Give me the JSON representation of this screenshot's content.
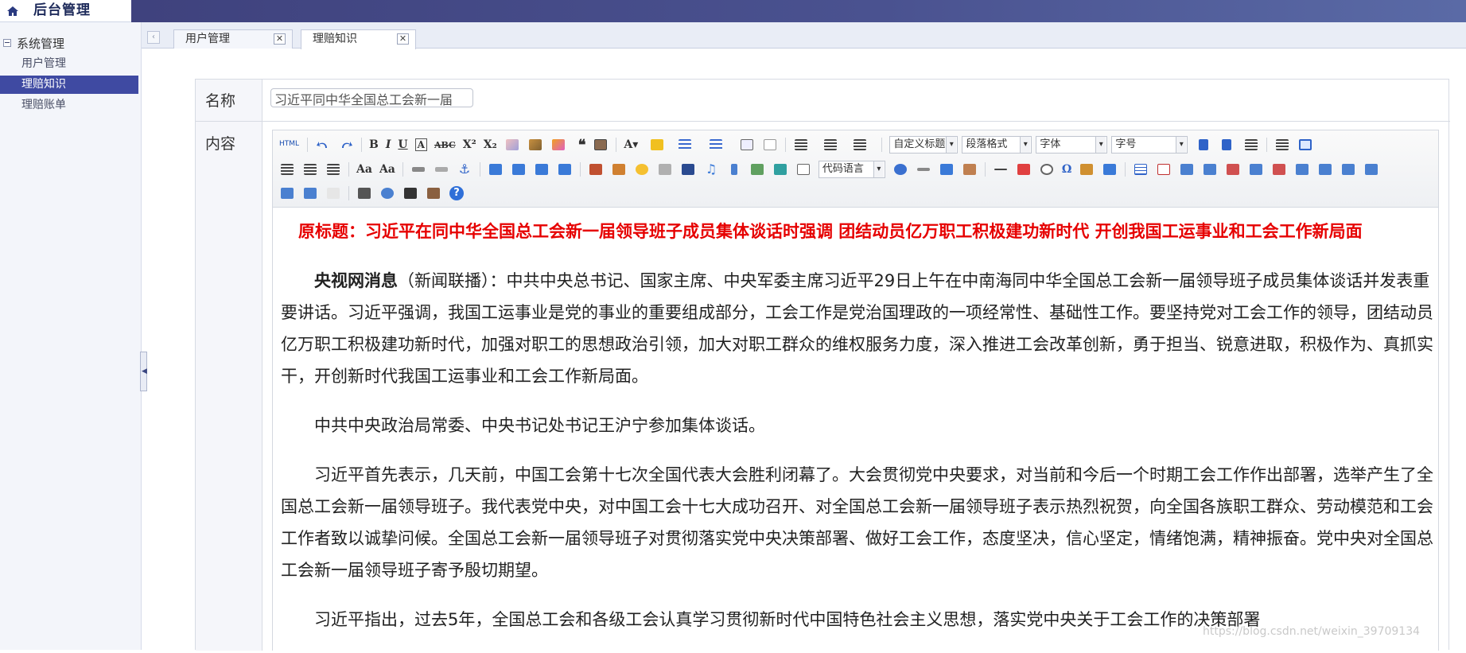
{
  "app": {
    "title": "后台管理"
  },
  "sidebar": {
    "group_label": "系统管理",
    "items": [
      {
        "label": "用户管理",
        "active": false
      },
      {
        "label": "理赔知识",
        "active": true
      },
      {
        "label": "理赔账单",
        "active": false
      }
    ]
  },
  "tabs": [
    {
      "label": "用户管理",
      "active": false
    },
    {
      "label": "理赔知识",
      "active": true
    }
  ],
  "form": {
    "name_label": "名称",
    "name_value": "习近平同中华全国总工会新一届",
    "content_label": "内容"
  },
  "toolbar": {
    "html_label": "HTML",
    "custom_title": "自定义标题",
    "paragraph_format": "段落格式",
    "font_family": "字体",
    "font_size": "字号",
    "code_language": "代码语言",
    "icons": [
      "html-icon",
      "undo-icon",
      "redo-icon",
      "bold-icon",
      "italic-icon",
      "underline-icon",
      "font-border-icon",
      "strikethrough-icon",
      "superscript-icon",
      "subscript-icon",
      "eraser-icon",
      "format-brush-icon",
      "autotype-icon",
      "blockquote-icon",
      "paste-text-icon",
      "font-color-icon",
      "back-color-icon",
      "ordered-list-icon",
      "unordered-list-icon",
      "select-all-icon",
      "clear-doc-icon",
      "row-spacing-top-icon",
      "row-spacing-bottom-icon",
      "line-height-icon",
      "ltr-icon",
      "rtl-icon",
      "indent-icon",
      "justify-left-icon",
      "justify-center-icon",
      "justify-right-icon",
      "justify-full-icon",
      "touppercase-icon",
      "tolowercase-icon",
      "link-icon",
      "unlink-icon",
      "anchor-icon",
      "image-none-icon",
      "image-left-icon",
      "image-right-icon",
      "image-center-icon",
      "simple-upload-icon",
      "insert-image-icon",
      "emotion-icon",
      "scrawl-icon",
      "insert-video-icon",
      "music-icon",
      "attachment-icon",
      "map-icon",
      "gmap-icon",
      "insert-frame-icon",
      "help-globe-icon",
      "page-break-icon",
      "background-icon",
      "template-icon",
      "horizontal-icon",
      "date-icon",
      "time-icon",
      "special-chars-icon",
      "word-image-icon",
      "snap-icon",
      "insert-table-icon",
      "delete-table-icon",
      "insert-paragraph-before-table-icon",
      "insert-row-icon",
      "delete-row-icon",
      "insert-col-icon",
      "delete-col-icon",
      "merge-cells-icon",
      "merge-right-icon",
      "merge-down-icon",
      "split-to-cells-icon",
      "split-to-rows-icon",
      "split-to-cols-icon",
      "charts-icon",
      "print-icon",
      "preview-icon",
      "search-replace-icon",
      "drafts-icon",
      "help-icon",
      "fullscreen-icon"
    ]
  },
  "article": {
    "headline": "原标题：习近平在同中华全国总工会新一届领导班子成员集体谈话时强调 团结动员亿万职工积极建功新时代 开创我国工运事业和工会工作新局面",
    "p1_lead": "央视网消息",
    "p1_body": "（新闻联播）：中共中央总书记、国家主席、中央军委主席习近平29日上午在中南海同中华全国总工会新一届领导班子成员集体谈话并发表重要讲话。习近平强调，我国工运事业是党的事业的重要组成部分，工会工作是党治国理政的一项经常性、基础性工作。要坚持党对工会工作的领导，团结动员亿万职工积极建功新时代，加强对职工的思想政治引领，加大对职工群众的维权服务力度，深入推进工会改革创新，勇于担当、锐意进取，积极作为、真抓实干，开创新时代我国工运事业和工会工作新局面。",
    "p2": "中共中央政治局常委、中央书记处书记王沪宁参加集体谈话。",
    "p3": "习近平首先表示，几天前，中国工会第十七次全国代表大会胜利闭幕了。大会贯彻党中央要求，对当前和今后一个时期工会工作作出部署，选举产生了全国总工会新一届领导班子。我代表党中央，对中国工会十七大成功召开、对全国总工会新一届领导班子表示热烈祝贺，向全国各族职工群众、劳动模范和工会工作者致以诚挚问候。全国总工会新一届领导班子对贯彻落实党中央决策部署、做好工会工作，态度坚决，信心坚定，情绪饱满，精神振奋。党中央对全国总工会新一届领导班子寄予殷切期望。",
    "p4": "习近平指出，过去5年，全国总工会和各级工会认真学习贯彻新时代中国特色社会主义思想，落实党中央关于工会工作的决策部署"
  },
  "watermark": "https://blog.csdn.net/weixin_39709134",
  "colors": {
    "accent": "#3f4aa2",
    "headline": "#e60000",
    "topbar": "#3d3f7a"
  }
}
